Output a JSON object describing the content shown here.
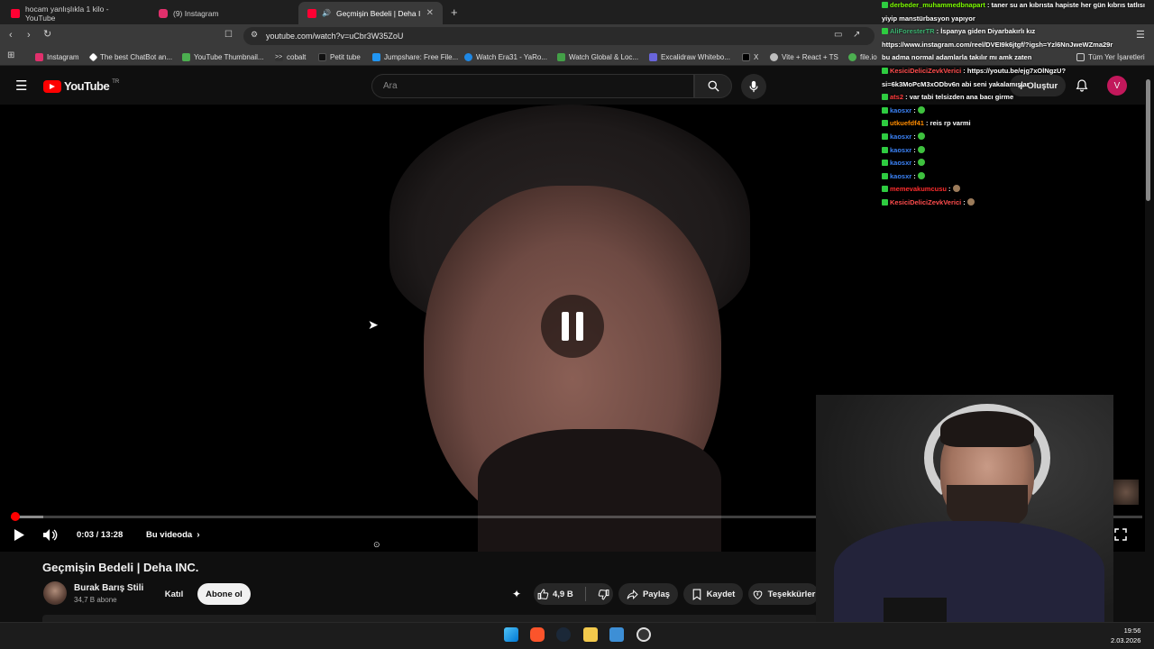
{
  "browser": {
    "tabs": [
      {
        "label": "hocam yanlışlıkla 1 kilo - YouTube",
        "active": false,
        "color": "#ff0033"
      },
      {
        "label": "(9) Instagram",
        "active": false,
        "color": "#e1306c"
      },
      {
        "label": "Geçmişin Bedeli | Deha INC. -",
        "active": true,
        "color": "#ff0033"
      }
    ],
    "url": "youtube.com/watch?v=uCbr3W35ZoU",
    "bookmarks": [
      {
        "label": "Instagram",
        "color": "#e1306c"
      },
      {
        "label": "The best ChatBot an...",
        "color": "#ffffff"
      },
      {
        "label": "YouTube Thumbnail...",
        "color": "#4caf50"
      },
      {
        "label": "cobalt",
        "color": "#dddddd"
      },
      {
        "label": "Petit tube",
        "color": "#222222"
      },
      {
        "label": "Jumpshare: Free File...",
        "color": "#2196f3"
      },
      {
        "label": "Watch Era31 - YaRo...",
        "color": "#1e88e5"
      },
      {
        "label": "Watch Global & Loc...",
        "color": "#43a047"
      },
      {
        "label": "Excalidraw Whitebo...",
        "color": "#6965db"
      },
      {
        "label": "X",
        "color": "#000000"
      },
      {
        "label": "Vite + React + TS",
        "color": "#bdbdbd"
      },
      {
        "label": "file.io",
        "color": "#4caf50"
      }
    ],
    "all_bookmarks_label": "Tüm Yer İşaretleri"
  },
  "youtube": {
    "logo_text": "YouTube",
    "region": "TR",
    "search_placeholder": "Ara",
    "create_label": "Oluştur",
    "avatar_letter": "V",
    "player": {
      "time": "0:03 / 13:28",
      "chapter_label": "Bu videoda",
      "progress_fraction": 0.004,
      "buffer_fraction": 0.029,
      "state": "paused"
    },
    "video_title": "Geçmişin Bedeli | Deha INC.",
    "channel": {
      "name": "Burak Barış Stili",
      "subscribers": "34,7 B abone"
    },
    "join_label": "Katıl",
    "subscribe_label": "Abone ol",
    "likes": "4,9 B",
    "share_label": "Paylaş",
    "save_label": "Kaydet",
    "thanks_label": "Teşekkürler"
  },
  "chat": [
    {
      "user": "derbeder_muhammedbnapart",
      "user_color": "#7cfc00",
      "text": "taner su an kıbrısta hapiste her gün kıbrıs tatlısı"
    },
    {
      "user": "",
      "user_color": "#ffffff",
      "text": "yiyip manstürbasyon yapıyor"
    },
    {
      "user": "AliForesterTR",
      "user_color": "#3cb371",
      "text": "İspanya giden Diyarbakırlı kız"
    },
    {
      "user": "",
      "user_color": "#ffffff",
      "text": "https://www.instagram.com/reel/DVEI9k6jtgf/?igsh=Yzl6NnJweWZma29r"
    },
    {
      "user": "",
      "user_color": "#ff4444",
      "text": "bu adma normal adamlarla takılır mı amk zaten"
    },
    {
      "user": "KesiciDeliciZevkVerici",
      "user_color": "#ff4d4d",
      "text": "https://youtu.be/ejg7xOlNgzU?"
    },
    {
      "user": "",
      "user_color": "#ffffff",
      "text": "si=6k3MoPcM3xODbv6n abi seni yakalamışlar"
    },
    {
      "user": "ats2",
      "user_color": "#ff3b3b",
      "text": "var tabi telsizden ana bacı girme"
    },
    {
      "user": "kaosxr",
      "user_color": "#3b82f6",
      "text": ""
    },
    {
      "user": "utkuefdf41",
      "user_color": "#ff8c00",
      "text": "reis rp varmi"
    },
    {
      "user": "kaosxr",
      "user_color": "#3b82f6",
      "text": ""
    },
    {
      "user": "kaosxr",
      "user_color": "#3b82f6",
      "text": ""
    },
    {
      "user": "kaosxr",
      "user_color": "#3b82f6",
      "text": ""
    },
    {
      "user": "kaosxr",
      "user_color": "#3b82f6",
      "text": ""
    },
    {
      "user": "memevakumcusu",
      "user_color": "#ff2d2d",
      "text": ""
    },
    {
      "user": "KesiciDeliciZevkVerici",
      "user_color": "#ff4d4d",
      "text": ""
    }
  ],
  "taskbar": {
    "time": "19:56",
    "date": "2.03.2026"
  },
  "colors": {
    "accent_red": "#ff0000",
    "chat_green_emote": "#3ec13e"
  }
}
